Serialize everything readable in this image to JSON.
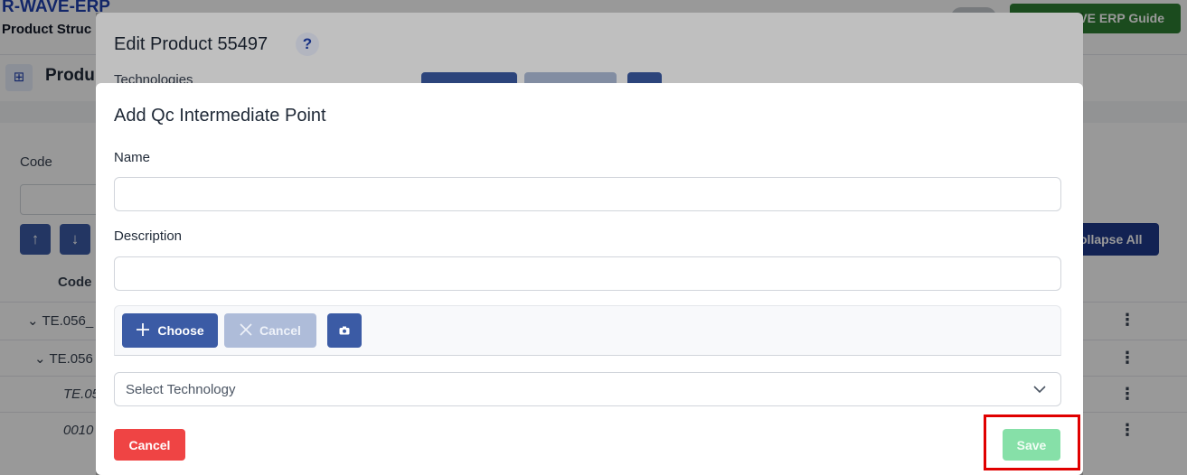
{
  "app": {
    "brand": "R-WAVE-ERP",
    "breadcrumb": "Product Struc",
    "guide_button": "VE ERP Guide",
    "page_title": "Produ"
  },
  "background": {
    "code_label": "Code",
    "collapse_all": "ollapse All",
    "table_header_code": "Code",
    "rows": [
      {
        "label": "TE.056_",
        "style": "normal"
      },
      {
        "label": "TE.056",
        "style": "normal"
      },
      {
        "label": "TE.05",
        "style": "italic"
      },
      {
        "label": "0010",
        "style": "italic"
      }
    ]
  },
  "edit_dialog": {
    "title": "Edit Product 55497",
    "help": "?",
    "technologies_label": "Technologies"
  },
  "qc_dialog": {
    "title": "Add Qc Intermediate Point",
    "name_label": "Name",
    "name_value": "",
    "description_label": "Description",
    "description_value": "",
    "choose_button": "Choose",
    "upload_cancel_button": "Cancel",
    "technology_placeholder": "Select Technology",
    "cancel_button": "Cancel",
    "save_button": "Save"
  },
  "colors": {
    "primary": "#3b5ba5",
    "danger": "#ef4444",
    "save_disabled": "#86e0a8",
    "highlight": "#e00000"
  }
}
